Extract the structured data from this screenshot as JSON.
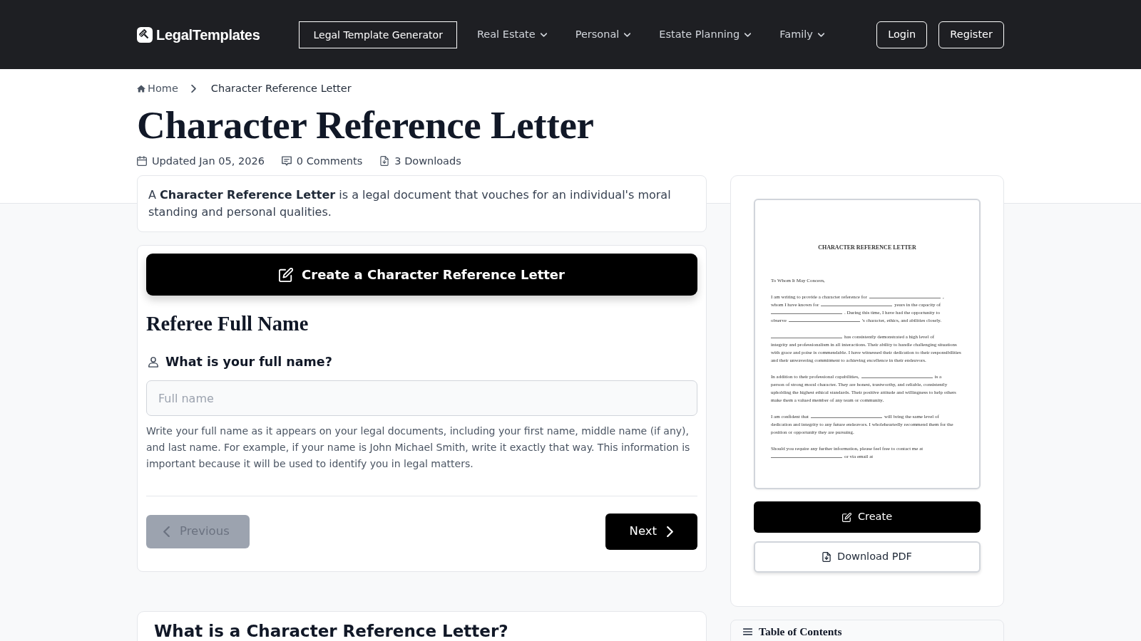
{
  "header": {
    "logo": "LegalTemplates",
    "nav": [
      {
        "kind": "outlined",
        "label": "Legal Template Generator"
      },
      {
        "kind": "dropdown",
        "label": "Real Estate"
      },
      {
        "kind": "dropdown",
        "label": "Personal"
      },
      {
        "kind": "dropdown",
        "label": "Estate Planning"
      },
      {
        "kind": "dropdown",
        "label": "Family"
      }
    ],
    "auth_buttons": [
      "Login",
      "Register"
    ]
  },
  "breadcrumb": [
    {
      "kind": "home",
      "label": "Home"
    },
    {
      "kind": "current",
      "label": "Character Reference Letter"
    }
  ],
  "title": "Character Reference Letter",
  "meta": [
    {
      "kind": "updated",
      "text": "Updated Jan 05, 2026"
    },
    {
      "kind": "comments",
      "text": "0 Comments"
    },
    {
      "kind": "downloads",
      "text": "3 Downloads"
    }
  ],
  "summary": "A **Character Reference Letter** is a legal document that vouches for an individual's moral standing and personal qualities.",
  "form": {
    "create_button": "Create a Character Reference Letter",
    "section_title": "Referee Full Name",
    "question": "What is your full name?",
    "field": {
      "placeholder": "Full name"
    },
    "help": "Write your full name as it appears on your legal documents, including your first name, middle name (if any), and last name. For example, if your name is John Michael Smith, write it exactly that way. This information is important because it will be used to identify you in legal matters.",
    "buttons": [
      {
        "kind": "previous",
        "label": "Previous",
        "disabled": true
      },
      {
        "kind": "next",
        "label": "Next",
        "disabled": false
      }
    ]
  },
  "preview": {
    "document": {
      "title": "CHARACTER REFERENCE LETTER",
      "salutation": "To Whom It May Concern,",
      "paragraphs": [
        {
          "lines": [
            [
              {
                "kind": "text",
                "text": "I am writing to provide a character reference for"
              },
              {
                "kind": "blank"
              },
              {
                "kind": "text",
                "text": ","
              }
            ],
            [
              {
                "kind": "text",
                "text": "whom I have known for"
              },
              {
                "kind": "blank"
              },
              {
                "kind": "text",
                "text": "years in the capacity of"
              }
            ],
            [
              {
                "kind": "blank"
              },
              {
                "kind": "text",
                "text": ". During this time, I have had the opportunity to"
              }
            ],
            [
              {
                "kind": "text",
                "text": "observe"
              },
              {
                "kind": "blank"
              },
              {
                "kind": "text",
                "text": "'s character, ethics, and abilities closely."
              }
            ]
          ]
        },
        {
          "lines": [
            [
              {
                "kind": "blank"
              },
              {
                "kind": "text",
                "text": "has consistently demonstrated a high level of"
              }
            ],
            [
              {
                "kind": "text",
                "text": "integrity and professionalism in all interactions. Their ability to handle challenging situations"
              }
            ],
            [
              {
                "kind": "text",
                "text": "with grace and poise is commendable. I have witnessed their dedication to their responsibilities"
              }
            ],
            [
              {
                "kind": "text",
                "text": "and their unwavering commitment to achieving excellence in their endeavors."
              }
            ]
          ]
        },
        {
          "lines": [
            [
              {
                "kind": "text",
                "text": "In addition to their professional capabilities,"
              },
              {
                "kind": "blank"
              },
              {
                "kind": "text",
                "text": "is a"
              }
            ],
            [
              {
                "kind": "text",
                "text": "person of strong moral character. They are honest, trustworthy, and reliable, consistently"
              }
            ],
            [
              {
                "kind": "text",
                "text": "upholding the highest ethical standards. Their positive attitude and willingness to help others"
              }
            ],
            [
              {
                "kind": "text",
                "text": "make them a valued member of any team or community."
              }
            ]
          ]
        },
        {
          "lines": [
            [
              {
                "kind": "text",
                "text": "I am confident that"
              },
              {
                "kind": "blank"
              },
              {
                "kind": "text",
                "text": "will bring the same level of"
              }
            ],
            [
              {
                "kind": "text",
                "text": "dedication and integrity to any future endeavors. I wholeheartedly recommend them for the"
              }
            ],
            [
              {
                "kind": "text",
                "text": "position or opportunity they are pursuing."
              }
            ]
          ]
        },
        {
          "lines": [
            [
              {
                "kind": "text",
                "text": "Should you require any further information, please feel free to contact me at"
              }
            ],
            [
              {
                "kind": "blank"
              },
              {
                "kind": "text",
                "text": "or via email at"
              }
            ]
          ]
        }
      ]
    },
    "buttons": [
      {
        "kind": "create",
        "label": "Create"
      },
      {
        "kind": "download",
        "label": "Download PDF"
      }
    ]
  },
  "next_section": {
    "heading": "What is a Character Reference Letter?"
  },
  "table_of_contents": {
    "title": "Table of Contents"
  }
}
